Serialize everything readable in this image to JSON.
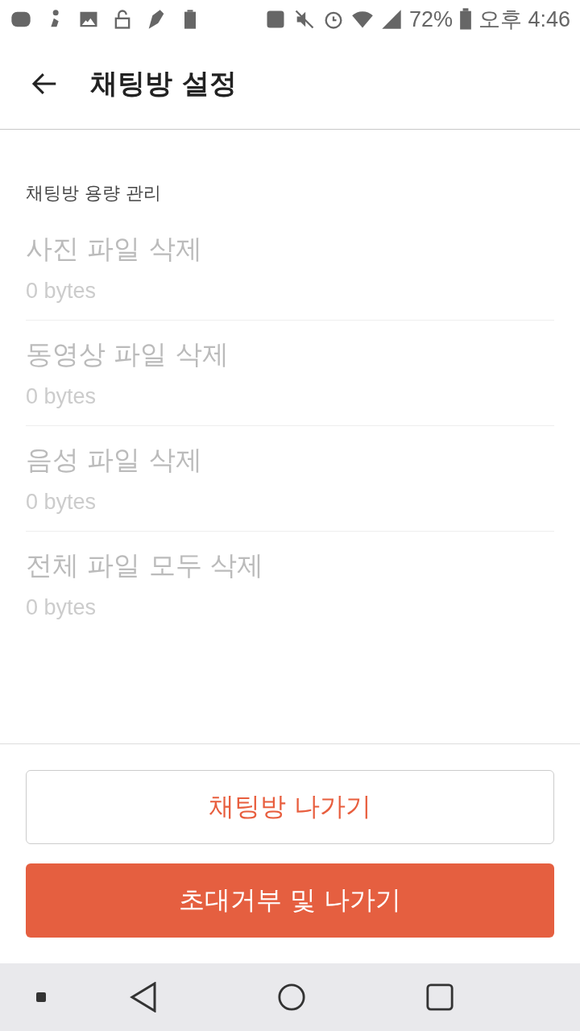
{
  "status_bar": {
    "battery": "72%",
    "time": "오후 4:46"
  },
  "header": {
    "title": "채팅방 설정"
  },
  "section": {
    "title": "채팅방 용량 관리",
    "items": [
      {
        "label": "사진 파일 삭제",
        "size": "0 bytes",
        "disabled": true
      },
      {
        "label": "동영상 파일 삭제",
        "size": "0 bytes",
        "disabled": true
      },
      {
        "label": "음성 파일 삭제",
        "size": "0 bytes",
        "disabled": true
      },
      {
        "label": "전체 파일 모두 삭제",
        "size": "0 bytes",
        "disabled": true
      }
    ]
  },
  "buttons": [
    {
      "label": "채팅방 나가기",
      "kind": "outline"
    },
    {
      "label": "초대거부 및 나가기",
      "kind": "filled"
    }
  ]
}
